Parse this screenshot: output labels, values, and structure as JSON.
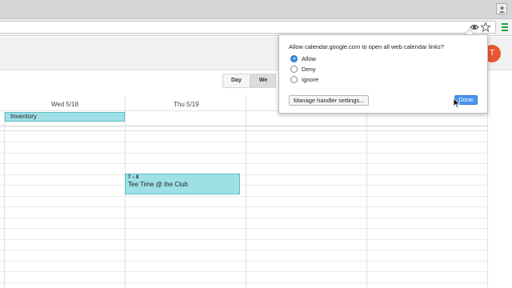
{
  "browser": {
    "profile_icon": "person-icon",
    "omnibox_icons": [
      "handler-eye-icon",
      "star-icon"
    ],
    "menu_icon": "hamburger-menu-icon"
  },
  "calendar": {
    "avatar_initial": "T",
    "view_buttons": [
      {
        "label": "Day",
        "active": false
      },
      {
        "label": "We",
        "active": true
      }
    ],
    "day_headers": [
      "Wed 5/18",
      "Thu 5/19"
    ],
    "allday_event": "Inventory",
    "timed_event": {
      "time": "7 – 8",
      "title": "Tee Time @ the Club"
    },
    "colors": {
      "event_fill": "#9fe0e6",
      "event_border": "#5bbdc6",
      "avatar": "#e9562f"
    }
  },
  "handler_popup": {
    "message": "Allow calendar.google.com to open all web calendar links?",
    "options": [
      {
        "label": "Allow",
        "checked": true
      },
      {
        "label": "Deny",
        "checked": false
      },
      {
        "label": "Ignore",
        "checked": false
      }
    ],
    "manage_label": "Manage handler settings...",
    "done_label": "Done",
    "colors": {
      "done_button": "#4c94ef",
      "radio_checked": "#3d8fe6"
    }
  }
}
